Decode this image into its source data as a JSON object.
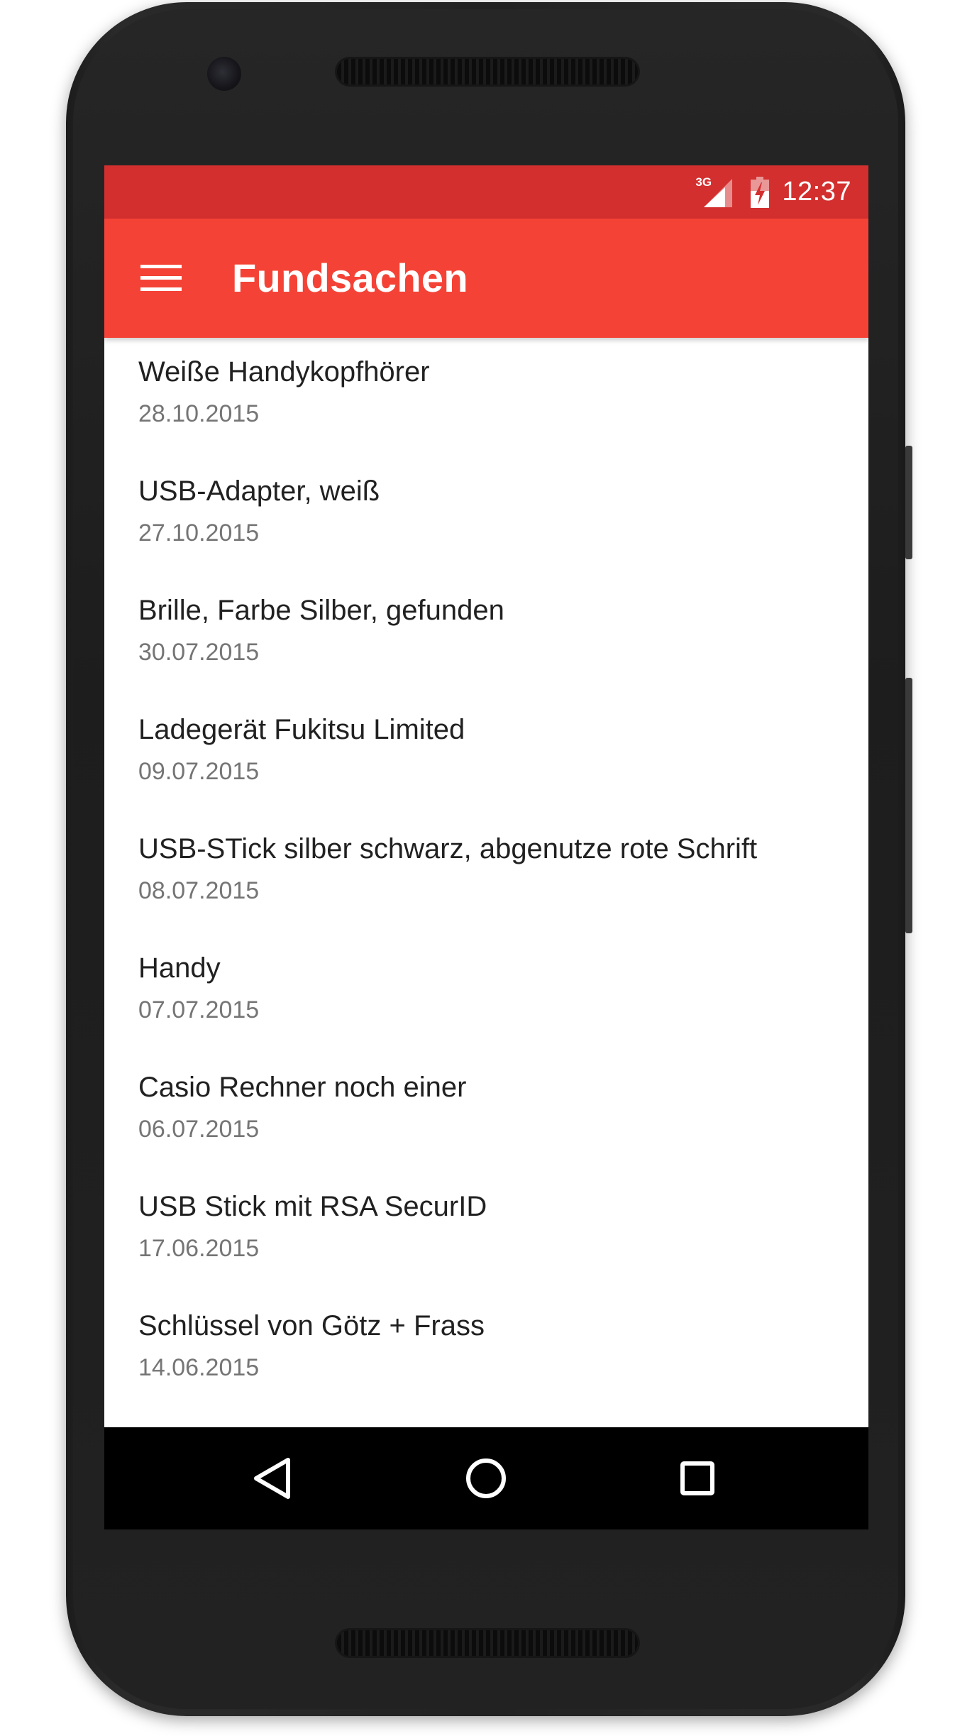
{
  "status_bar": {
    "network": "3G",
    "time": "12:37"
  },
  "app_bar": {
    "title": "Fundsachen",
    "menu_icon": "hamburger-menu-icon"
  },
  "items": [
    {
      "title": "Weiße Handykopfhörer",
      "date": "28.10.2015"
    },
    {
      "title": "USB-Adapter, weiß",
      "date": "27.10.2015"
    },
    {
      "title": "Brille, Farbe Silber, gefunden",
      "date": "30.07.2015"
    },
    {
      "title": "Ladegerät Fukitsu Limited",
      "date": "09.07.2015"
    },
    {
      "title": "USB-STick silber schwarz, abgenutze rote Schrift",
      "date": "08.07.2015"
    },
    {
      "title": "Handy",
      "date": "07.07.2015"
    },
    {
      "title": "Casio Rechner noch einer",
      "date": "06.07.2015"
    },
    {
      "title": "USB Stick mit RSA SecurID",
      "date": "17.06.2015"
    },
    {
      "title": "Schlüssel von Götz + Frass",
      "date": "14.06.2015"
    }
  ],
  "nav_bar": {
    "back_icon": "back-triangle-icon",
    "home_icon": "home-circle-icon",
    "recents_icon": "recents-square-icon"
  },
  "colors": {
    "status_bar": "#d32f2f",
    "app_bar": "#f44336",
    "primary_text": "#212121",
    "secondary_text": "#757575"
  }
}
